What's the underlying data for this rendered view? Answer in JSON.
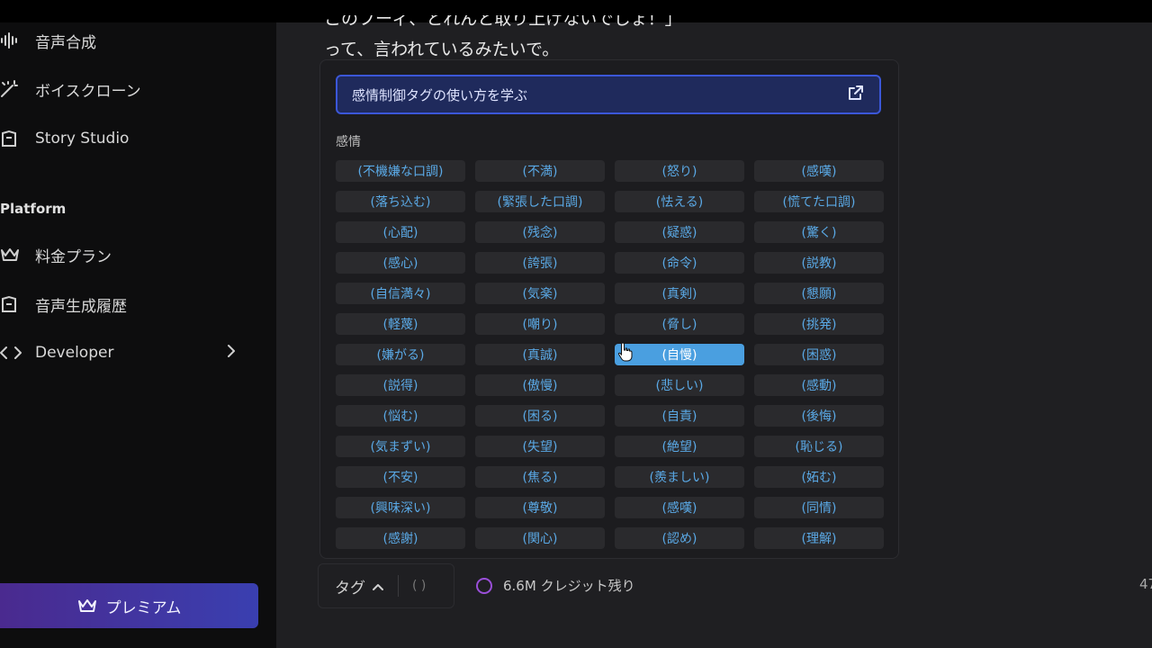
{
  "sidebar": {
    "items": [
      {
        "label": "音声合成",
        "icon": "waveform-icon"
      },
      {
        "label": "ボイスクローン",
        "icon": "magic-wand-icon"
      },
      {
        "label": "Story Studio",
        "icon": "book-icon"
      }
    ],
    "section_label": "Platform",
    "platform_items": [
      {
        "label": "料金プラン",
        "icon": "crown-icon"
      },
      {
        "label": "音声生成履歴",
        "icon": "history-icon"
      },
      {
        "label": "Developer",
        "icon": "code-icon"
      }
    ],
    "premium_label": "プレミアム"
  },
  "main": {
    "partial_line": "このフーィ、とれんと取り上げないでしょ！」",
    "line2": "って、言われているみたいで。"
  },
  "panel": {
    "learn_link": "感情制御タグの使い方を学ぶ",
    "section_label": "感情",
    "tags": [
      "(不機嫌な口調)",
      "(不満)",
      "(怒り)",
      "(感嘆)",
      "(落ち込む)",
      "(緊張した口調)",
      "(怯える)",
      "(慌てた口調)",
      "(心配)",
      "(残念)",
      "(疑惑)",
      "(驚く)",
      "(感心)",
      "(誇張)",
      "(命令)",
      "(説教)",
      "(自信満々)",
      "(気楽)",
      "(真剣)",
      "(懇願)",
      "(軽蔑)",
      "(嘲り)",
      "(脅し)",
      "(挑発)",
      "(嫌がる)",
      "(真誠)",
      "(自慢)",
      "(困惑)",
      "(説得)",
      "(傲慢)",
      "(悲しい)",
      "(感動)",
      "(悩む)",
      "(困る)",
      "(自責)",
      "(後悔)",
      "(気まずい)",
      "(失望)",
      "(絶望)",
      "(恥じる)",
      "(不安)",
      "(焦る)",
      "(羨ましい)",
      "(妬む)",
      "(興味深い)",
      "(尊敬)",
      "(感嘆)",
      "(同情)",
      "(感謝)",
      "(関心)",
      "(認め)",
      "(理解)"
    ],
    "selected_tag": "(自慢)"
  },
  "toolbar": {
    "tag_label": "タグ",
    "bracket_label": "( )",
    "credits": "6.6M クレジット残り",
    "counter": "47"
  },
  "colors": {
    "accent_blue": "#4a9fe0",
    "tag_text": "#5aa9e6",
    "link_border": "#3b57d8",
    "credit_ring": "#9a4fd9"
  }
}
